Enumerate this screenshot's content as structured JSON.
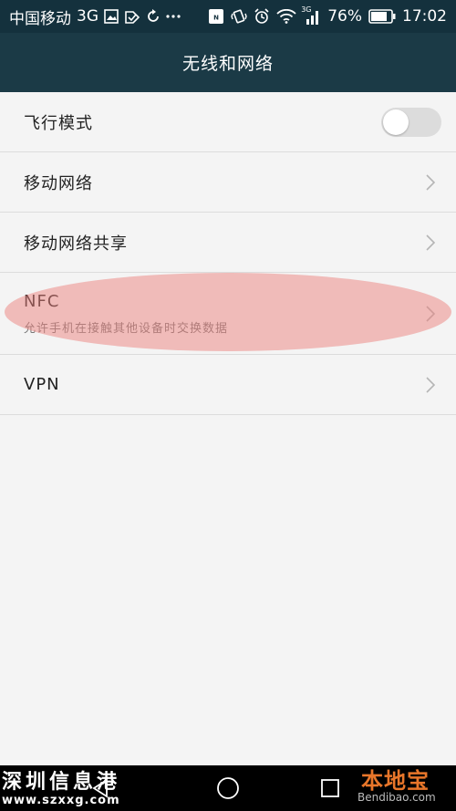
{
  "status_bar": {
    "carrier": "中国移动",
    "network": "3G",
    "small_network": "3G",
    "battery": "76%",
    "time": "17:02",
    "icons_left": [
      "image-icon",
      "tag-check-icon",
      "sync-icon",
      "more-icon"
    ],
    "icons_right": [
      "nfc-icon",
      "vibrate-icon",
      "alarm-icon",
      "wifi-icon",
      "signal-icon",
      "battery-icon"
    ]
  },
  "header": {
    "title": "无线和网络"
  },
  "settings": {
    "airplane": {
      "label": "飞行模式",
      "enabled": false
    },
    "mobile_network": {
      "label": "移动网络"
    },
    "tethering": {
      "label": "移动网络共享"
    },
    "nfc": {
      "label": "NFC",
      "description": "允许手机在接触其他设备时交换数据"
    },
    "vpn": {
      "label": "VPN"
    }
  },
  "colors": {
    "status_bar_bg": "#14313d",
    "action_bar_bg": "#1b3a46",
    "list_bg": "#f4f4f4",
    "highlight": "#ec827e",
    "watermark_brand": "#e8762a"
  },
  "watermarks": {
    "left_title": "深圳信息港",
    "left_url": "www.szxxg.com",
    "right_brand": "本地宝",
    "right_url": "Bendibao.com"
  }
}
